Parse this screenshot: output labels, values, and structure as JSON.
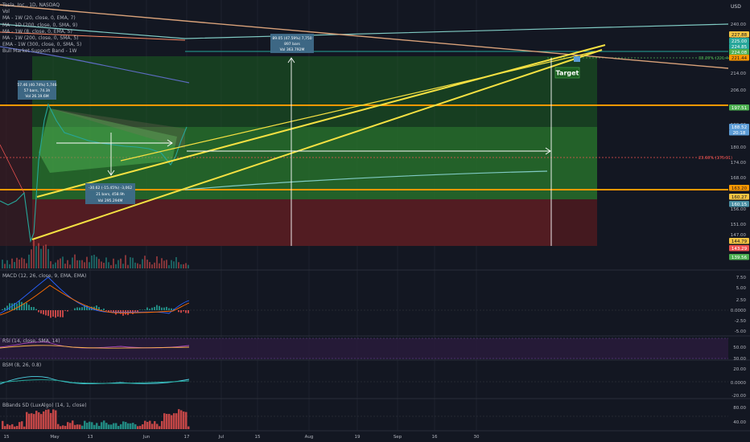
{
  "legend": {
    "title": "Tesla, Inc., 1D, NASDAQ",
    "lines": [
      "Vol",
      "MA - 1W (20, close, 0, EMA, 7)",
      "MA - 1D (200, close, 0, SMA, 9)",
      "MA - 1W (8, close, 0, EMA, 5)",
      "MA - 1W (200, close, 0, SMA, 5)",
      "EMA - 1W (300, close, 0, SMA, 5)",
      "Bull Market Support Band - 1W"
    ]
  },
  "currency": "USD",
  "price_axis": {
    "ticks": [
      "240.00",
      "230.00",
      "214.00",
      "206.00",
      "190.00",
      "180.00",
      "174.00",
      "168.00",
      "156.00",
      "151.00",
      "147.00"
    ],
    "tags": [
      {
        "text": "227.88",
        "bg": "#f5c542",
        "fg": "#131722"
      },
      {
        "text": "225.00",
        "bg": "#26a69a",
        "fg": "#ffffff"
      },
      {
        "text": "224.85",
        "bg": "#26a69a",
        "fg": "#ffffff"
      },
      {
        "text": "224.08",
        "bg": "#4caf50",
        "fg": "#ffffff"
      },
      {
        "text": "221.44",
        "bg": "#ff9800",
        "fg": "#131722"
      },
      {
        "text": "197.51",
        "bg": "#4caf50",
        "fg": "#ffffff"
      },
      {
        "text": "188.52",
        "bg": "#5b9bd5",
        "fg": "#ffffff"
      },
      {
        "text": "20:18",
        "bg": "#5b9bd5",
        "fg": "#ffffff"
      },
      {
        "text": "163.20",
        "bg": "#ff9800",
        "fg": "#131722"
      },
      {
        "text": "160.27",
        "bg": "#f5c542",
        "fg": "#131722"
      },
      {
        "text": "160.15",
        "bg": "#4a90a4",
        "fg": "#ffffff"
      },
      {
        "text": "144.79",
        "bg": "#f5c542",
        "fg": "#131722"
      },
      {
        "text": "143.29",
        "bg": "#ef5350",
        "fg": "#ffffff"
      },
      {
        "text": "139.56",
        "bg": "#4caf50",
        "fg": "#ffffff"
      }
    ]
  },
  "time_axis": [
    "15",
    "May",
    "13",
    "Jun",
    "17",
    "Jul",
    "15",
    "Aug",
    "19",
    "Sep",
    "16",
    "30"
  ],
  "annotations": {
    "target_label": "Target",
    "fib_382": "38.20% (221.44)",
    "fib_236": "23.60% (175.91)",
    "long_box": [
      "57.46 (40.74%) 5,746",
      "57 bars, 74.3h",
      "Vol 26.19.6M"
    ],
    "short_box": [
      "-30.62 (-15.45%) -3,062",
      "21 bars, 458.9h",
      "Vol 295.294M"
    ],
    "proj_box": [
      "89.05 (47.59%) 7,750",
      "897 bars",
      "Vol 363.792M"
    ]
  },
  "macd": {
    "label": "MACD (12, 26, close, 9, EMA, EMA)",
    "ticks": [
      "7.50",
      "5.00",
      "2.50",
      "0.0000",
      "-2.50",
      "-5.00"
    ]
  },
  "rsi": {
    "label": "RSI (14, close, SMA, 14)",
    "ticks": [
      "50.00",
      "30.00"
    ]
  },
  "bsm": {
    "label": "BSM (8, 26, 0.8)",
    "ticks": [
      "20.00",
      "0.0000",
      "-20.00"
    ]
  },
  "bbands": {
    "label": "BBands SD (LuxAlgo) (14, 1, close)",
    "ticks": [
      "80.00",
      "40.00"
    ]
  },
  "chart_data": {
    "type": "line",
    "title": "Tesla, Inc., 1D, NASDAQ",
    "x": [
      "15",
      "May",
      "13",
      "Jun",
      "17",
      "Jul",
      "15",
      "Aug",
      "19",
      "Sep",
      "16",
      "30"
    ],
    "ylim": [
      139.56,
      240.0
    ],
    "levels": [
      {
        "name": "resistance",
        "value": 197.51,
        "color": "#ff9800"
      },
      {
        "name": "support",
        "value": 163.2,
        "color": "#ff9800"
      },
      {
        "name": "fib 38.20%",
        "value": 221.44,
        "color": "#4caf50"
      },
      {
        "name": "fib 23.60%",
        "value": 175.91,
        "color": "#ef5350"
      }
    ],
    "last_price": 188.52,
    "target": 224.08
  }
}
